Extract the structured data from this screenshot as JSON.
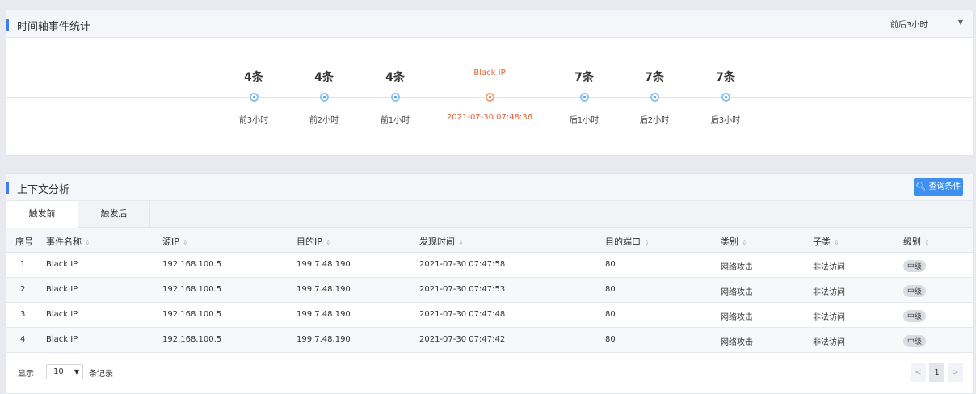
{
  "timeline": {
    "title": "时间轴事件统计",
    "range_select": "前后3小时",
    "nodes": [
      {
        "count": "4条",
        "label": "前3小时"
      },
      {
        "count": "4条",
        "label": "前2小时"
      },
      {
        "count": "4条",
        "label": "前1小时"
      },
      {
        "flag": "Black IP",
        "label": "2021-07-30 07:48:36",
        "current": true
      },
      {
        "count": "7条",
        "label": "后1小时"
      },
      {
        "count": "7条",
        "label": "后2小时"
      },
      {
        "count": "7条",
        "label": "后3小时"
      }
    ]
  },
  "context": {
    "title": "上下文分析",
    "query_button": "查询条件",
    "tabs": [
      "触发前",
      "触发后"
    ],
    "columns": [
      "序号",
      "事件名称",
      "源IP",
      "目的IP",
      "发现时间",
      "目的端口",
      "类别",
      "子类",
      "级别"
    ],
    "rows": [
      [
        "1",
        "Black IP",
        "192.168.100.5",
        "199.7.48.190",
        "2021-07-30 07:47:58",
        "80",
        "网络攻击",
        "非法访问",
        "中级"
      ],
      [
        "2",
        "Black IP",
        "192.168.100.5",
        "199.7.48.190",
        "2021-07-30 07:47:53",
        "80",
        "网络攻击",
        "非法访问",
        "中级"
      ],
      [
        "3",
        "Black IP",
        "192.168.100.5",
        "199.7.48.190",
        "2021-07-30 07:47:48",
        "80",
        "网络攻击",
        "非法访问",
        "中级"
      ],
      [
        "4",
        "Black IP",
        "192.168.100.5",
        "199.7.48.190",
        "2021-07-30 07:47:42",
        "80",
        "网络攻击",
        "非法访问",
        "中级"
      ]
    ],
    "footer": {
      "show_label": "显示",
      "page_size": "10",
      "records_label": "条记录",
      "prev": "<",
      "current_page": "1",
      "next": ">"
    }
  },
  "colors": {
    "accent": "#3d7ff5",
    "current_event": "#e0653a",
    "button": "#3d8ff0"
  }
}
